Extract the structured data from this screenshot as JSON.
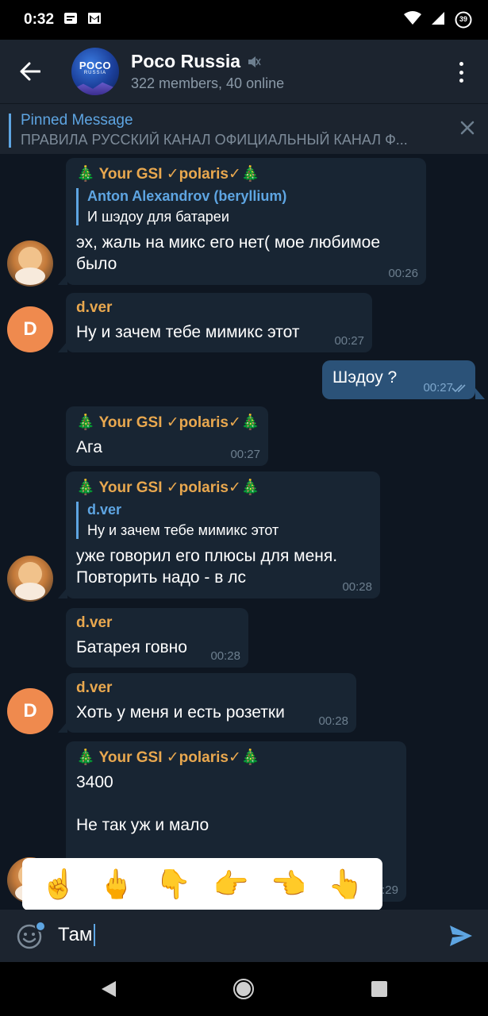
{
  "status_bar": {
    "time": "0:32",
    "battery_level": "39"
  },
  "header": {
    "back_icon": "arrow-left-icon",
    "avatar_text": "POCO",
    "avatar_subtext": "RUSSIA",
    "title": "Poco Russia",
    "subtitle": "322 members, 40 online",
    "muted_icon": "muted-speaker-icon",
    "menu_icon": "more-vert-icon"
  },
  "pinned": {
    "title": "Pinned Message",
    "text": "ПРАВИЛА РУССКИЙ КАНАЛ ОФИЦИАЛЬНЫЙ КАНАЛ Ф...",
    "close_icon": "close-icon"
  },
  "messages": [
    {
      "sender": "🎄 Your GSI ✓polaris✓🎄",
      "reply_name": "Anton Alexandrov (beryllium)",
      "reply_text": "И шэдоу для батареи",
      "text": "эх, жаль на микс его нет( мое любимое\nбыло",
      "time": "00:26"
    },
    {
      "sender": "d.ver",
      "text": "Ну и зачем тебе мимикс этот",
      "time": "00:27"
    },
    {
      "text": "Шэдоу ?",
      "time": "00:27"
    },
    {
      "sender": "🎄 Your GSI ✓polaris✓🎄",
      "text": "Ага",
      "time": "00:27"
    },
    {
      "sender": "🎄 Your GSI ✓polaris✓🎄",
      "reply_name": "d.ver",
      "reply_text": "Ну и зачем тебе мимикс этот",
      "text": "уже говорил его плюсы для меня.\nПовторить надо - в лс",
      "time": "00:28"
    },
    {
      "sender": "d.ver",
      "text": "Батарея говно",
      "time": "00:28"
    },
    {
      "sender": "d.ver",
      "text": "Хоть у меня и есть розетки",
      "time": "00:28"
    },
    {
      "sender": "🎄 Your GSI ✓polaris✓🎄",
      "text": "3400\n\nНе так уж и мало\n\nУ меня у друга xz1 sony, вот там мало",
      "time": "00:29"
    }
  ],
  "avatars": {
    "d_letter": "D"
  },
  "emoji_suggestions": [
    "☝️",
    "🖕",
    "👇",
    "👉",
    "👈",
    "👆"
  ],
  "input": {
    "text": "Там",
    "emoji_icon": "smile-icon",
    "send_icon": "send-icon"
  },
  "colors": {
    "accent": "#5ea5e2",
    "sender_orange": "#e9a84f",
    "bg": "#0e1621",
    "bubble_in": "#182533",
    "bubble_out": "#2b5278"
  }
}
